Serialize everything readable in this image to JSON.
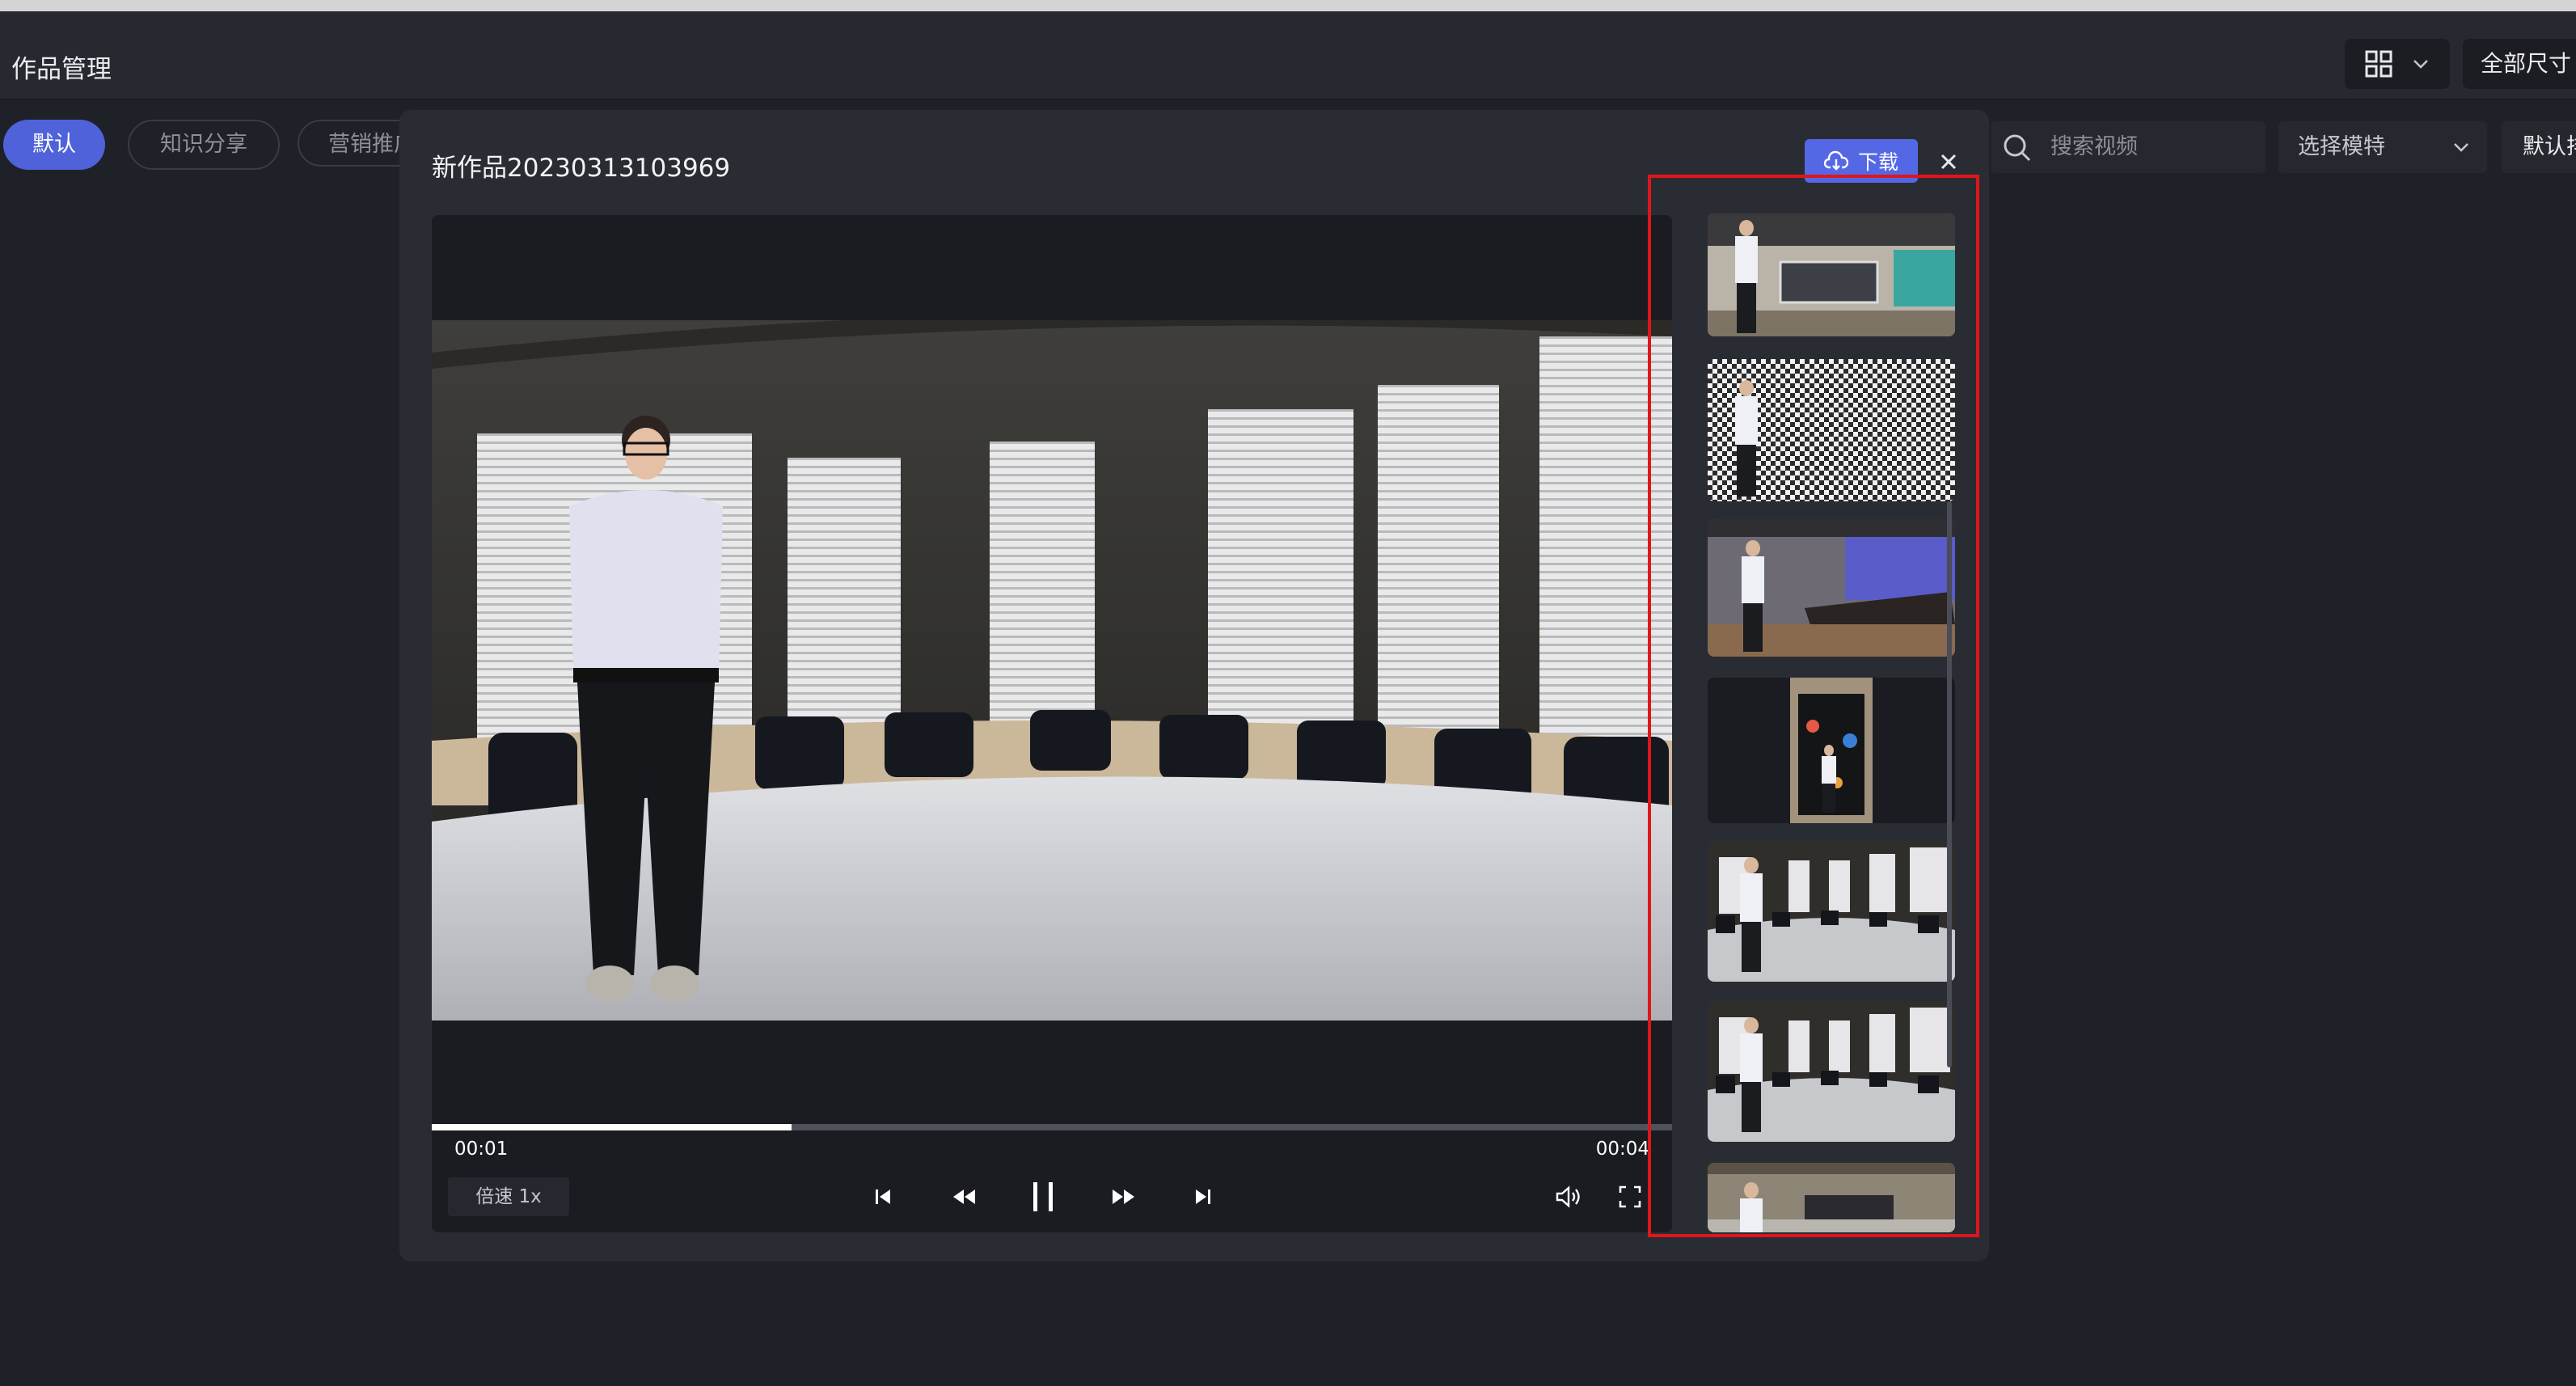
{
  "header": {
    "title": "作品管理",
    "size_filter": "全部尺寸"
  },
  "categories": [
    {
      "label": "默认",
      "active": true
    },
    {
      "label": "知识分享",
      "active": false
    },
    {
      "label": "营销推广",
      "active": false
    }
  ],
  "filters": {
    "search_placeholder": "搜索视频",
    "model_select": "选择模特",
    "sort_select": "默认排序"
  },
  "modal": {
    "title": "新作品20230313103969",
    "download_label": "下载",
    "close_icon": "close-icon"
  },
  "player": {
    "current_time": "00:01",
    "total_time": "00:04",
    "progress_fraction": 0.29,
    "speed_label": "倍速 1x",
    "controls": [
      "skip-back-icon",
      "rewind-icon",
      "pause-icon",
      "fast-forward-icon",
      "skip-forward-icon",
      "volume-icon",
      "fullscreen-icon"
    ]
  },
  "thumbnails": [
    {
      "scene": "office-room"
    },
    {
      "scene": "transparent-checker"
    },
    {
      "scene": "meeting-room-blue"
    },
    {
      "scene": "vertical-dark-poster"
    },
    {
      "scene": "round-conference-room"
    },
    {
      "scene": "round-conference-room"
    },
    {
      "scene": "office-lobby"
    }
  ],
  "colors": {
    "accent": "#4f62d9",
    "download": "#5468e6",
    "highlight": "#e0151a",
    "background": "#1f2129",
    "modal": "#2a2c33"
  }
}
